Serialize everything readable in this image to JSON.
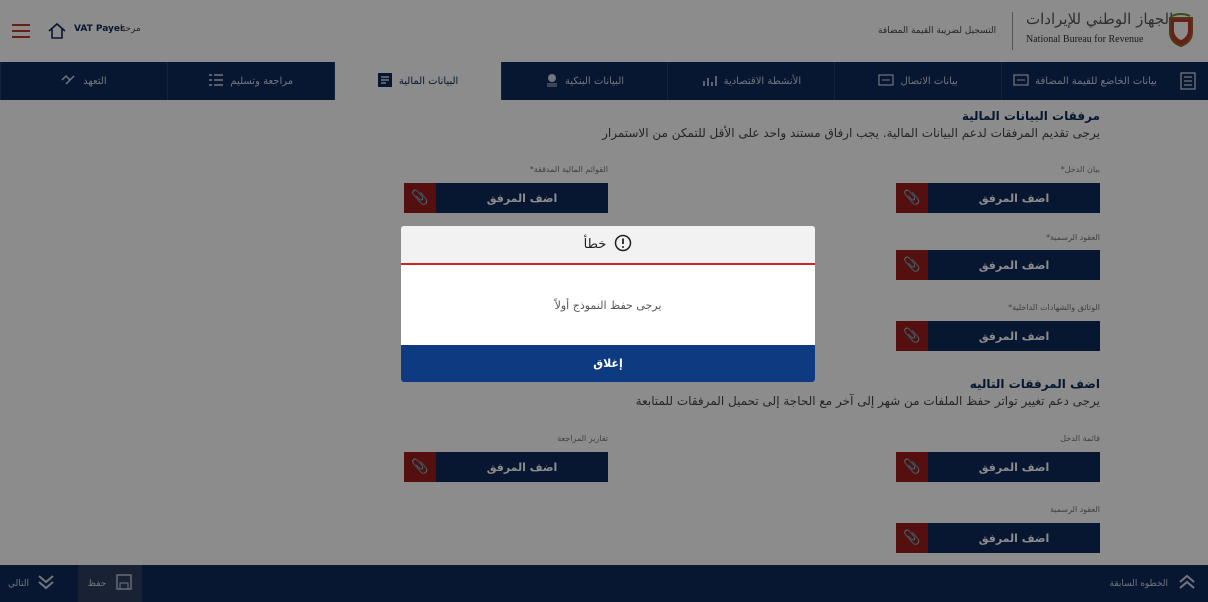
{
  "header": {
    "greeting": "مرحبا",
    "user": "VAT Payer",
    "page_heading": "التسجيل لضريبة القيمة المضافة",
    "org_name_ar": "الجهاز الوطني للإيرادات",
    "org_name_en": "National Bureau for Revenue"
  },
  "nav": {
    "tabs": [
      {
        "label": "بيانات الخاضع للقيمة المضافة"
      },
      {
        "label": "بيانات الاتصال"
      },
      {
        "label": "الأنشطة الاقتصادية"
      },
      {
        "label": "البيانات البنكية"
      },
      {
        "label": "البيانات المالية"
      },
      {
        "label": "مراجعة وتسليم"
      },
      {
        "label": "التعهد"
      }
    ]
  },
  "section1": {
    "title": "مرفقات البيانات المالية",
    "desc": "يرجى تقديم المرفقات لدعم البيانات المالية. يجب ارفاق مستند واحد على الأقل للتمكن من الاستمرار"
  },
  "fields1": {
    "income_statement": "بيان الدخل*",
    "audited_statements": "القوائم المالية المدققة*",
    "official_contracts": "العقود الرسمية*",
    "internal_docs": "الوثائق والشهادات الداخلية*"
  },
  "section2": {
    "title": "اضف المرفقات التاليه",
    "desc": "يرجى دعم تغيير تواتر حفظ الملفات من شهر إلى آخر مع الحاجة إلى تحميل المرفقات للمتابعة"
  },
  "fields2": {
    "income_list": "قائمة الدخل",
    "audit_reports": "تقارير المراجعة",
    "official_contracts": "العقود الرسمية"
  },
  "attach_label": "اضف المرفق",
  "footer": {
    "prev": "الخطوه السابقة",
    "save": "حفظ",
    "next": "التالي"
  },
  "modal": {
    "title": "خطأ",
    "message": "يرجى حفظ النموذج أولاً",
    "close": "إغلاق"
  },
  "colors": {
    "navy": "#0d2a5a",
    "red": "#9b1c1c"
  }
}
